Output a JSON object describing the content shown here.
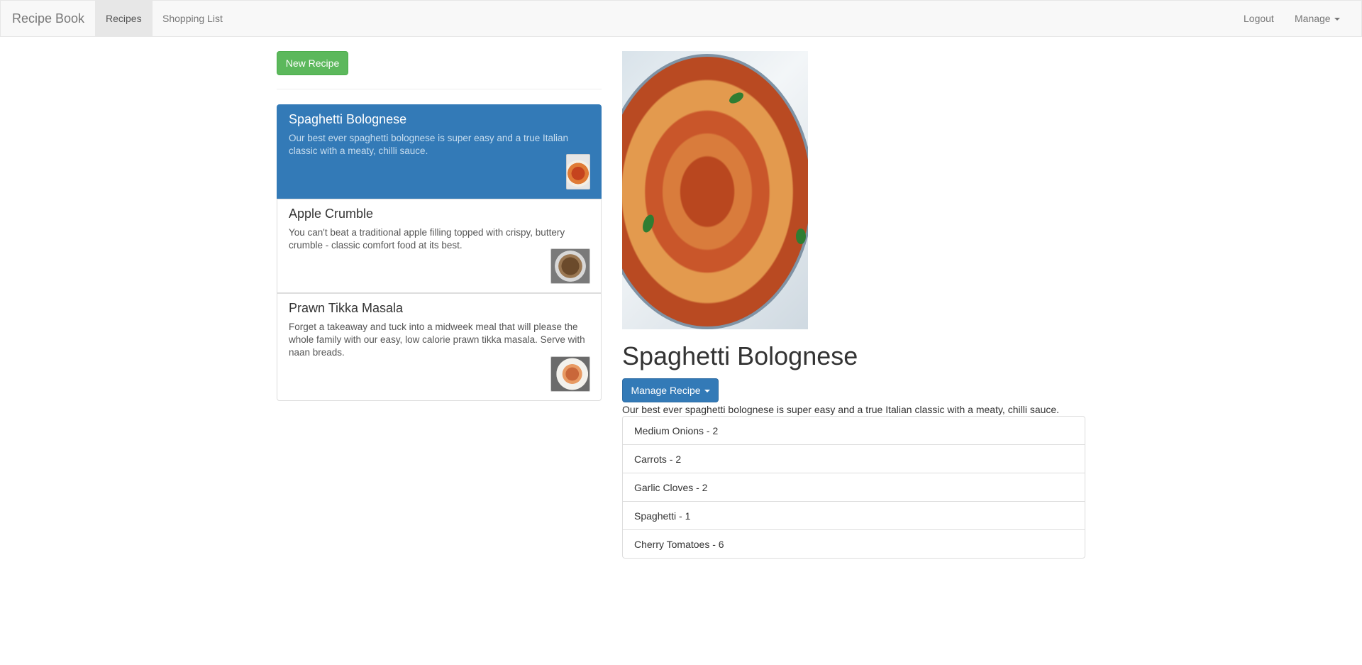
{
  "navbar": {
    "brand": "Recipe Book",
    "links": [
      "Recipes",
      "Shopping List"
    ],
    "active_link": "Recipes",
    "right": {
      "logout": "Logout",
      "manage": "Manage"
    }
  },
  "sidebar": {
    "new_recipe_label": "New Recipe",
    "recipes": [
      {
        "name": "Spaghetti Bolognese",
        "description": "Our best ever spaghetti bolognese is super easy and a true Italian classic with a meaty, chilli sauce.",
        "thumbnail": "spaghetti-thumbnail",
        "active": true
      },
      {
        "name": "Apple Crumble",
        "description": "You can't beat a traditional apple filling topped with crispy, buttery crumble - classic comfort food at its best.",
        "thumbnail": "apple-crumble-thumbnail",
        "active": false
      },
      {
        "name": "Prawn Tikka Masala",
        "description": "Forget a takeaway and tuck into a midweek meal that will please the whole family with our easy, low calorie prawn tikka masala. Serve with naan breads.",
        "thumbnail": "prawn-tikka-thumbnail",
        "active": false
      }
    ]
  },
  "detail": {
    "image": "spaghetti-bolognese-photo",
    "title": "Spaghetti Bolognese",
    "manage_label": "Manage Recipe",
    "description": "Our best ever spaghetti bolognese is super easy and a true Italian classic with a meaty, chilli sauce.",
    "ingredients": [
      "Medium Onions - 2",
      "Carrots - 2",
      "Garlic Cloves - 2",
      "Spaghetti - 1",
      "Cherry Tomatoes - 6"
    ]
  },
  "colors": {
    "primary": "#337ab7",
    "success": "#5cb85c",
    "navbar_bg": "#f8f8f8"
  }
}
